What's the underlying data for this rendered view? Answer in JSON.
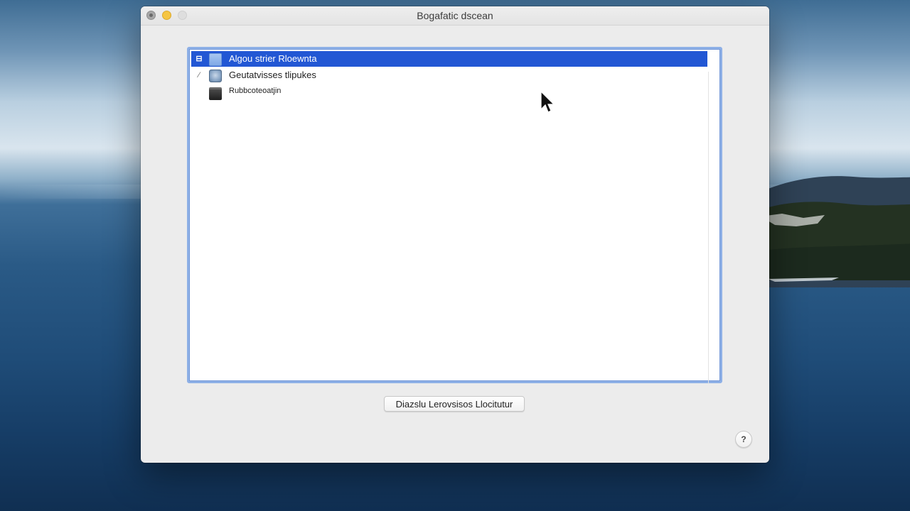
{
  "window": {
    "title": "Bogafatic dscean"
  },
  "list": {
    "items": [
      {
        "disclosure": "⊟",
        "label": "Algou strier Rloewnta",
        "icon": "blue-document-icon",
        "selected": true
      },
      {
        "disclosure": "⁄",
        "label": "Geutatvisses tlipukes",
        "icon": "disk-icon",
        "selected": false
      },
      {
        "disclosure": "",
        "label": "Rubbcoteoatjin",
        "icon": "dark-folder-icon",
        "selected": false
      }
    ]
  },
  "footer": {
    "button_label": "Diazslu Lerovsisos Llocitutur"
  },
  "help": {
    "label": "?"
  },
  "colors": {
    "selection": "#2257d4",
    "list_border": "#8eb0e6",
    "minimize": "#f5c542"
  }
}
